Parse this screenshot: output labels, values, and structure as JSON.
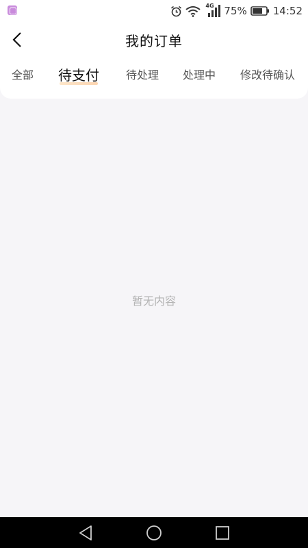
{
  "status_bar": {
    "network": "4G",
    "battery": "75%",
    "time": "14:52"
  },
  "header": {
    "title": "我的订单"
  },
  "tabs": [
    {
      "label": "全部",
      "active": false
    },
    {
      "label": "待支付",
      "active": true
    },
    {
      "label": "待处理",
      "active": false
    },
    {
      "label": "处理中",
      "active": false
    },
    {
      "label": "修改待确认",
      "active": false
    }
  ],
  "empty_state": {
    "text": "暂无内容"
  },
  "nav_bar": {
    "icons": [
      "back-triangle-icon",
      "home-circle-icon",
      "recents-square-icon"
    ]
  },
  "colors": {
    "background": "#f6f5f8",
    "card": "#ffffff",
    "tab_indicator": "#fbd0a8"
  }
}
